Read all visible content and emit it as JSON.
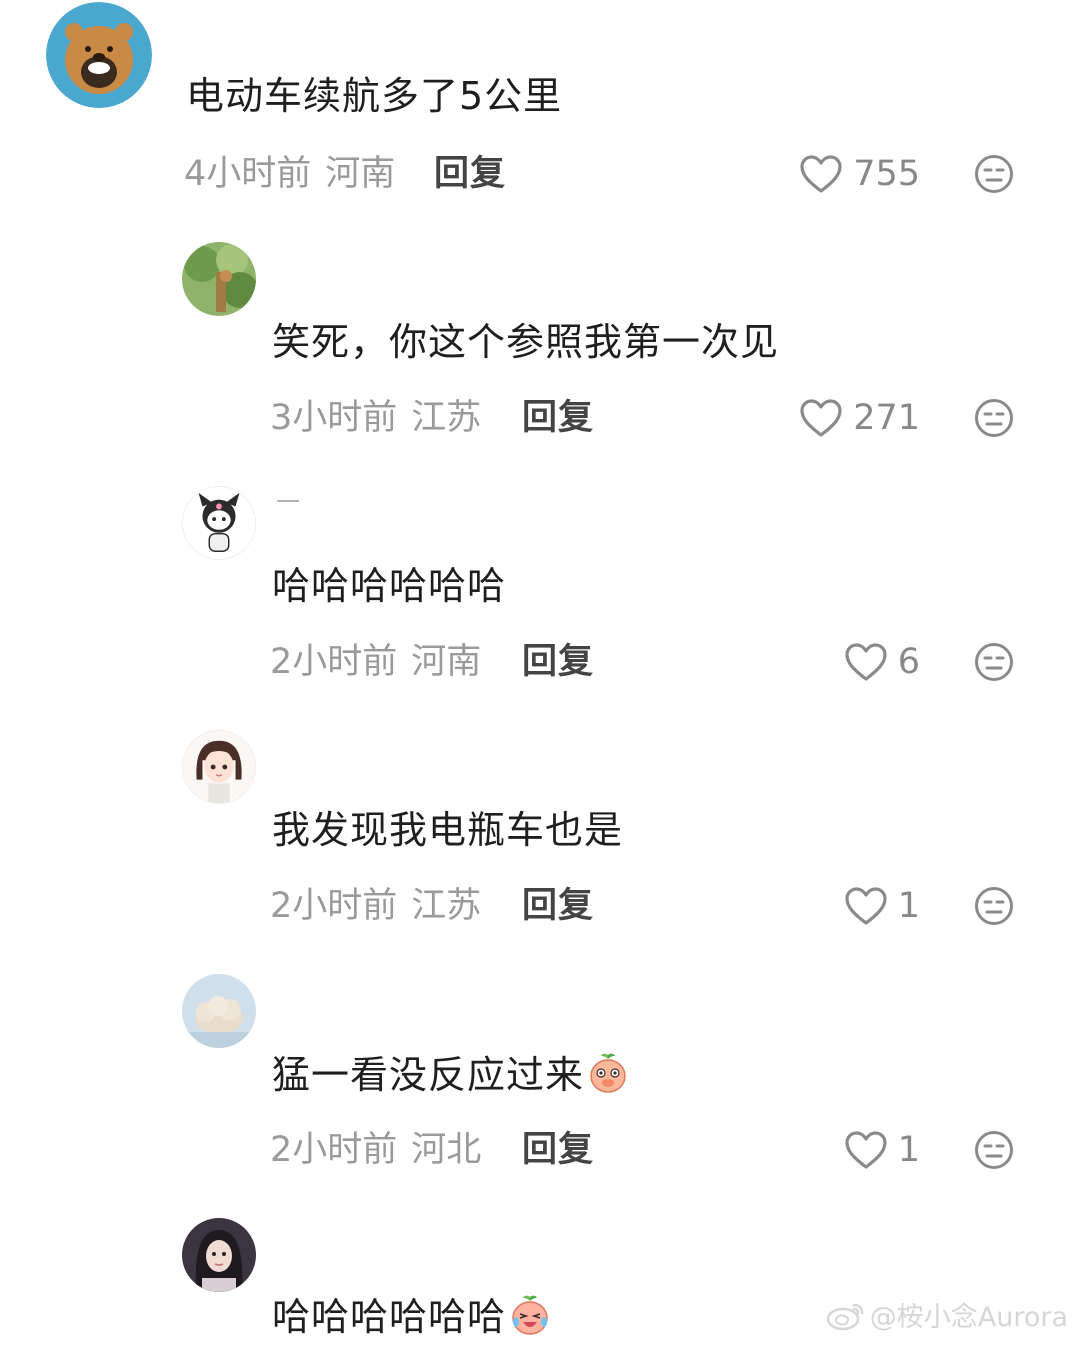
{
  "comments": [
    {
      "username": "",
      "text": "电动车续航多了5公里",
      "time": "4小时前",
      "region": "河南",
      "reply": "回复",
      "likes": "755",
      "emoji": ""
    },
    {
      "username": "",
      "text": "笑死，你这个参照我第一次见",
      "time": "3小时前",
      "region": "江苏",
      "reply": "回复",
      "likes": "271",
      "emoji": ""
    },
    {
      "username": "一",
      "text": "哈哈哈哈哈哈",
      "time": "2小时前",
      "region": "河南",
      "reply": "回复",
      "likes": "6",
      "emoji": ""
    },
    {
      "username": "",
      "text": "我发现我电瓶车也是",
      "time": "2小时前",
      "region": "江苏",
      "reply": "回复",
      "likes": "1",
      "emoji": ""
    },
    {
      "username": "",
      "text": "猛一看没反应过来",
      "time": "2小时前",
      "region": "河北",
      "reply": "回复",
      "likes": "1",
      "emoji": "peach-covering-mouth-emoji"
    },
    {
      "username": "",
      "text": "哈哈哈哈哈哈",
      "time": "",
      "region": "",
      "reply": "",
      "likes": "",
      "emoji": "peach-crying-laughing-emoji"
    }
  ],
  "watermark": {
    "text": "@桉小念Aurora",
    "icon": "weibo-logo-icon"
  },
  "icons": {
    "like": "heart-outline-icon",
    "dislike": "meh-face-icon"
  },
  "colors": {
    "text": "#1f1f1f",
    "meta": "#9a9a9a",
    "reply": "#444444",
    "icon": "#8a8a8a"
  }
}
